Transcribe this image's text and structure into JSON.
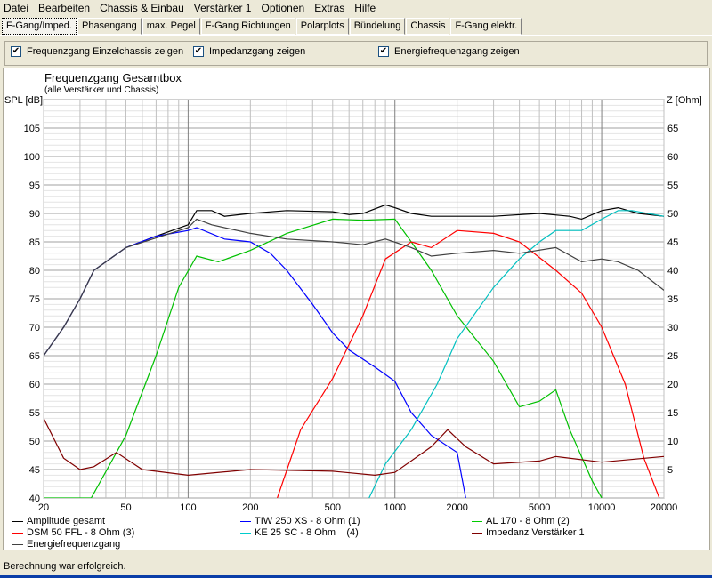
{
  "menu": [
    "Datei",
    "Bearbeiten",
    "Chassis & Einbau",
    "Verstärker 1",
    "Optionen",
    "Extras",
    "Hilfe"
  ],
  "tabs": [
    "F-Gang/Imped.",
    "Phasengang",
    "max. Pegel",
    "F-Gang Richtungen",
    "Polarplots",
    "Bündelung",
    "Chassis",
    "F-Gang elektr."
  ],
  "options": [
    {
      "label": "Frequenzgang Einzelchassis zeigen",
      "checked": true
    },
    {
      "label": "Impedanzgang zeigen",
      "checked": true
    },
    {
      "label": "Energiefrequenzgang zeigen",
      "checked": true
    }
  ],
  "status": "Berechnung war erfolgreich.",
  "chart_data": {
    "type": "line",
    "title": "Frequenzgang Gesamtbox",
    "subtitle": "(alle Verstärker und Chassis)",
    "ylabel": "SPL [dB]",
    "y2label": "Z [Ohm]",
    "xscale": "log",
    "xlim": [
      20,
      20000
    ],
    "ylim": [
      40,
      110
    ],
    "y2lim": [
      0,
      70
    ],
    "xticks": [
      20,
      50,
      100,
      200,
      500,
      1000,
      2000,
      5000,
      10000,
      20000
    ],
    "yticks": [
      40,
      45,
      50,
      55,
      60,
      65,
      70,
      75,
      80,
      85,
      90,
      95,
      100,
      105
    ],
    "y2ticks": [
      5,
      10,
      15,
      20,
      25,
      30,
      35,
      40,
      45,
      50,
      55,
      60,
      65
    ],
    "series": [
      {
        "name": "Amplitude gesamt",
        "color": "#000000",
        "axis": "left",
        "points": [
          [
            20,
            65
          ],
          [
            25,
            70
          ],
          [
            30,
            75
          ],
          [
            35,
            80
          ],
          [
            50,
            84
          ],
          [
            70,
            86
          ],
          [
            100,
            88
          ],
          [
            110,
            90.5
          ],
          [
            130,
            90.5
          ],
          [
            150,
            89.5
          ],
          [
            200,
            90
          ],
          [
            300,
            90.5
          ],
          [
            500,
            90.3
          ],
          [
            600,
            89.8
          ],
          [
            700,
            90
          ],
          [
            900,
            91.5
          ],
          [
            1000,
            91
          ],
          [
            1200,
            90
          ],
          [
            1500,
            89.5
          ],
          [
            2000,
            89.5
          ],
          [
            3000,
            89.5
          ],
          [
            5000,
            90
          ],
          [
            7000,
            89.5
          ],
          [
            8000,
            89
          ],
          [
            10000,
            90.5
          ],
          [
            12000,
            91
          ],
          [
            15000,
            90
          ],
          [
            20000,
            89.5
          ]
        ]
      },
      {
        "name": "TIW 250 XS - 8 Ohm (1)",
        "color": "#0000ff",
        "axis": "left",
        "points": [
          [
            20,
            65
          ],
          [
            25,
            70
          ],
          [
            30,
            75
          ],
          [
            35,
            80
          ],
          [
            50,
            84
          ],
          [
            70,
            86
          ],
          [
            100,
            87
          ],
          [
            110,
            87.5
          ],
          [
            150,
            85.5
          ],
          [
            200,
            85
          ],
          [
            250,
            83
          ],
          [
            300,
            80
          ],
          [
            400,
            74
          ],
          [
            500,
            69
          ],
          [
            600,
            66
          ],
          [
            800,
            63
          ],
          [
            1000,
            60.5
          ],
          [
            1200,
            55
          ],
          [
            1500,
            51
          ],
          [
            2000,
            48
          ],
          [
            2200,
            40
          ]
        ]
      },
      {
        "name": "AL 170 - 8 Ohm (2)",
        "color": "#00c000",
        "axis": "left",
        "points": [
          [
            20,
            40
          ],
          [
            34,
            40
          ],
          [
            50,
            51
          ],
          [
            70,
            65
          ],
          [
            90,
            77
          ],
          [
            110,
            82.5
          ],
          [
            140,
            81.5
          ],
          [
            200,
            83.5
          ],
          [
            300,
            86.5
          ],
          [
            500,
            89
          ],
          [
            700,
            88.8
          ],
          [
            1000,
            89
          ],
          [
            1200,
            85
          ],
          [
            1500,
            80
          ],
          [
            2000,
            72
          ],
          [
            3000,
            64
          ],
          [
            4000,
            56
          ],
          [
            5000,
            57
          ],
          [
            6000,
            59
          ],
          [
            7000,
            52
          ],
          [
            9000,
            43
          ],
          [
            10000,
            40
          ]
        ]
      },
      {
        "name": "DSM 50 FFL - 8 Ohm (3)",
        "color": "#ff0000",
        "axis": "left",
        "points": [
          [
            270,
            40
          ],
          [
            350,
            52
          ],
          [
            500,
            61
          ],
          [
            700,
            72
          ],
          [
            900,
            82
          ],
          [
            1200,
            85
          ],
          [
            1500,
            84
          ],
          [
            2000,
            87
          ],
          [
            3000,
            86.5
          ],
          [
            4000,
            85
          ],
          [
            6000,
            80
          ],
          [
            8000,
            76
          ],
          [
            10000,
            70
          ],
          [
            13000,
            60
          ],
          [
            16000,
            47
          ],
          [
            19000,
            40
          ]
        ]
      },
      {
        "name": "KE 25 SC - 8 Ohm    (4)",
        "color": "#00c0c0",
        "axis": "left",
        "points": [
          [
            750,
            40
          ],
          [
            900,
            46
          ],
          [
            1200,
            52
          ],
          [
            1600,
            60
          ],
          [
            2000,
            68
          ],
          [
            3000,
            77
          ],
          [
            4000,
            82
          ],
          [
            5000,
            85
          ],
          [
            6000,
            87
          ],
          [
            8000,
            87
          ],
          [
            10000,
            89
          ],
          [
            12000,
            90.5
          ],
          [
            14000,
            90.5
          ],
          [
            20000,
            89.5
          ]
        ]
      },
      {
        "name": "Impedanz Verstärker 1",
        "color": "#800000",
        "axis": "right",
        "points": [
          [
            20,
            14
          ],
          [
            25,
            7
          ],
          [
            30,
            5
          ],
          [
            35,
            5.5
          ],
          [
            45,
            8
          ],
          [
            60,
            5
          ],
          [
            100,
            4
          ],
          [
            200,
            5
          ],
          [
            500,
            4.7
          ],
          [
            800,
            4
          ],
          [
            1000,
            4.5
          ],
          [
            1500,
            9
          ],
          [
            1800,
            12
          ],
          [
            2200,
            9
          ],
          [
            3000,
            6
          ],
          [
            5000,
            6.5
          ],
          [
            6000,
            7.3
          ],
          [
            10000,
            6.3
          ],
          [
            20000,
            7.3
          ]
        ]
      },
      {
        "name": "Energiefrequenzgang",
        "color": "#404040",
        "axis": "left",
        "points": [
          [
            20,
            65
          ],
          [
            25,
            70
          ],
          [
            30,
            75
          ],
          [
            35,
            80
          ],
          [
            50,
            84
          ],
          [
            100,
            87.5
          ],
          [
            110,
            89
          ],
          [
            130,
            88
          ],
          [
            200,
            86.5
          ],
          [
            300,
            85.5
          ],
          [
            500,
            85
          ],
          [
            700,
            84.5
          ],
          [
            900,
            85.5
          ],
          [
            1200,
            84
          ],
          [
            1500,
            82.5
          ],
          [
            2000,
            83
          ],
          [
            3000,
            83.5
          ],
          [
            4000,
            83
          ],
          [
            6000,
            84
          ],
          [
            8000,
            81.5
          ],
          [
            10000,
            82
          ],
          [
            12000,
            81.5
          ],
          [
            15000,
            80
          ],
          [
            20000,
            76.5
          ]
        ]
      }
    ]
  }
}
